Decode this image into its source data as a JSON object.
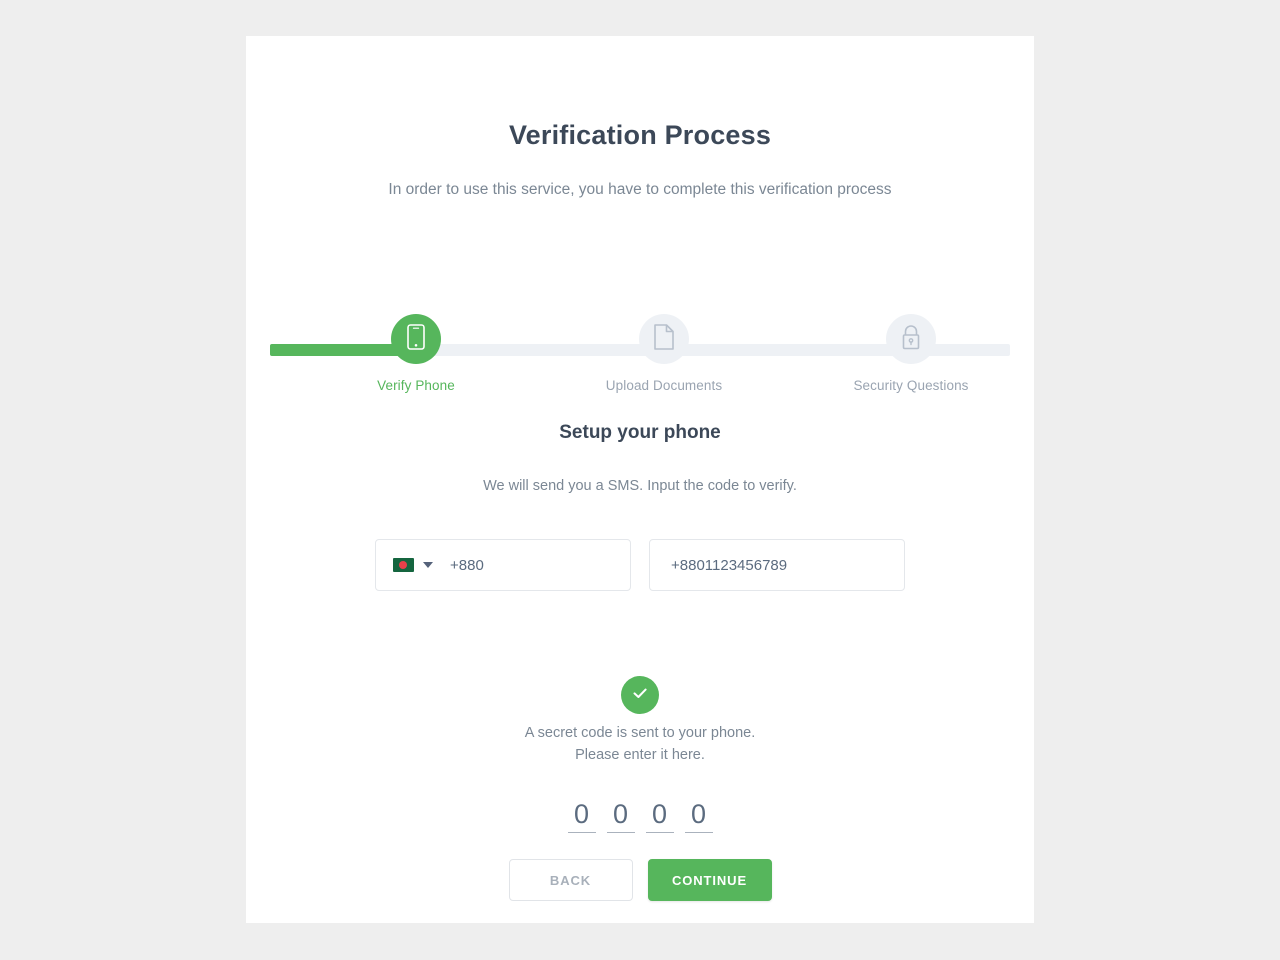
{
  "header": {
    "title": "Verification Process",
    "subtitle": "In order to use this service, you have to complete this verification process"
  },
  "stepper": {
    "active_index": 0,
    "steps": [
      {
        "label": "Verify Phone",
        "icon": "smartphone-icon",
        "state": "active"
      },
      {
        "label": "Upload Documents",
        "icon": "document-icon",
        "state": "inactive"
      },
      {
        "label": "Security Questions",
        "icon": "lock-icon",
        "state": "inactive"
      }
    ],
    "colors": {
      "active": "#56b65c",
      "inactive_track": "#eef1f5",
      "inactive_label": "#9aa4b1"
    }
  },
  "main": {
    "section_title": "Setup your phone",
    "section_subtitle": "We will send you a SMS. Input the code to verify.",
    "country_selector": {
      "flag": "bangladesh-flag",
      "dial_code": "+880",
      "caret": "chevron-down-icon"
    },
    "phone_input": {
      "value": "+8801123456789",
      "placeholder": "+8801123456789"
    },
    "confirmation": {
      "icon": "check-icon",
      "line1": "A secret code is sent to your phone.",
      "line2": "Please enter it here."
    },
    "otp": {
      "digits": [
        "0",
        "0",
        "0",
        "0"
      ]
    }
  },
  "footer": {
    "back_label": "BACK",
    "continue_label": "CONTINUE"
  }
}
